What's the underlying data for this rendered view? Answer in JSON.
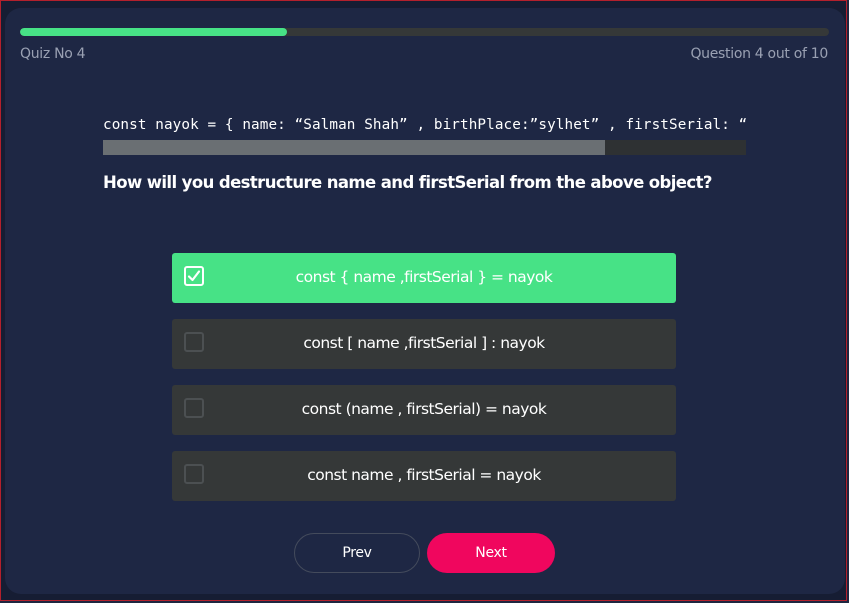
{
  "quiz": {
    "label": "Quiz No 4",
    "question_count": "Question 4 out of 10",
    "progress_fraction": 0.33
  },
  "code": {
    "text": "const nayok = { name: “Salman Shah” , birthPlace:”sylhet” , firstSerial: “Dondo” , firstMovie: “Keyamot Theke Keyamot” }",
    "scroll_visible_fraction": 0.78
  },
  "question": {
    "text": "How will you destructure name and firstSerial from the above object?"
  },
  "options": [
    {
      "label": "const { name ,firstSerial } = nayok",
      "selected": true
    },
    {
      "label": "const [ name ,firstSerial ] : nayok",
      "selected": false
    },
    {
      "label": "const (name , firstSerial) = nayok",
      "selected": false
    },
    {
      "label": "const name , firstSerial = nayok",
      "selected": false
    }
  ],
  "buttons": {
    "prev_label": "Prev",
    "next_label": "Next"
  },
  "colors": {
    "accent_green": "#47e286",
    "next_button": "#f0065e",
    "card_background": "#1e2744",
    "option_background": "#353838"
  },
  "icons": {
    "checked": "check-icon"
  }
}
